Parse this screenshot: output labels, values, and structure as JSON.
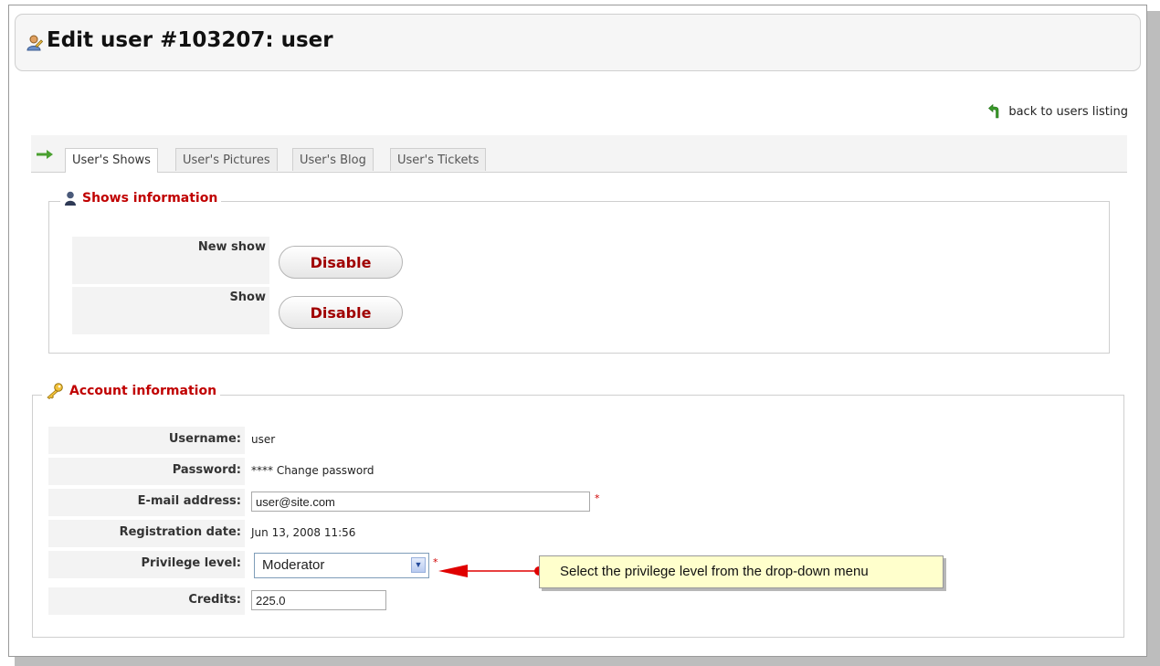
{
  "page": {
    "title": "Edit user #103207: user",
    "back_link": "back to users listing"
  },
  "tabs": [
    {
      "label": "User's Shows",
      "active": true
    },
    {
      "label": "User's Pictures",
      "active": false
    },
    {
      "label": "User's Blog",
      "active": false
    },
    {
      "label": "User's Tickets",
      "active": false
    }
  ],
  "shows_section": {
    "legend": "Shows information",
    "rows": [
      {
        "label": "New show",
        "button": "Disable"
      },
      {
        "label": "Show",
        "button": "Disable"
      }
    ]
  },
  "account_section": {
    "legend": "Account information",
    "username": {
      "label": "Username:",
      "value": "user"
    },
    "password": {
      "label": "Password:",
      "value": "**** Change password"
    },
    "email": {
      "label": "E-mail address:",
      "value": "user@site.com"
    },
    "registration": {
      "label": "Registration date:",
      "value": "Jun 13, 2008 11:56"
    },
    "privilege": {
      "label": "Privilege level:",
      "value": "Moderator"
    },
    "credits": {
      "label": "Credits:",
      "value": "225.0"
    },
    "required_mark": "*"
  },
  "annotation": {
    "text": "Select the privilege level from the drop-down menu"
  },
  "colors": {
    "legend_red": "#c00000",
    "button_text": "#a00000",
    "callout_bg": "#ffffcc",
    "arrow_red": "#e00000"
  }
}
